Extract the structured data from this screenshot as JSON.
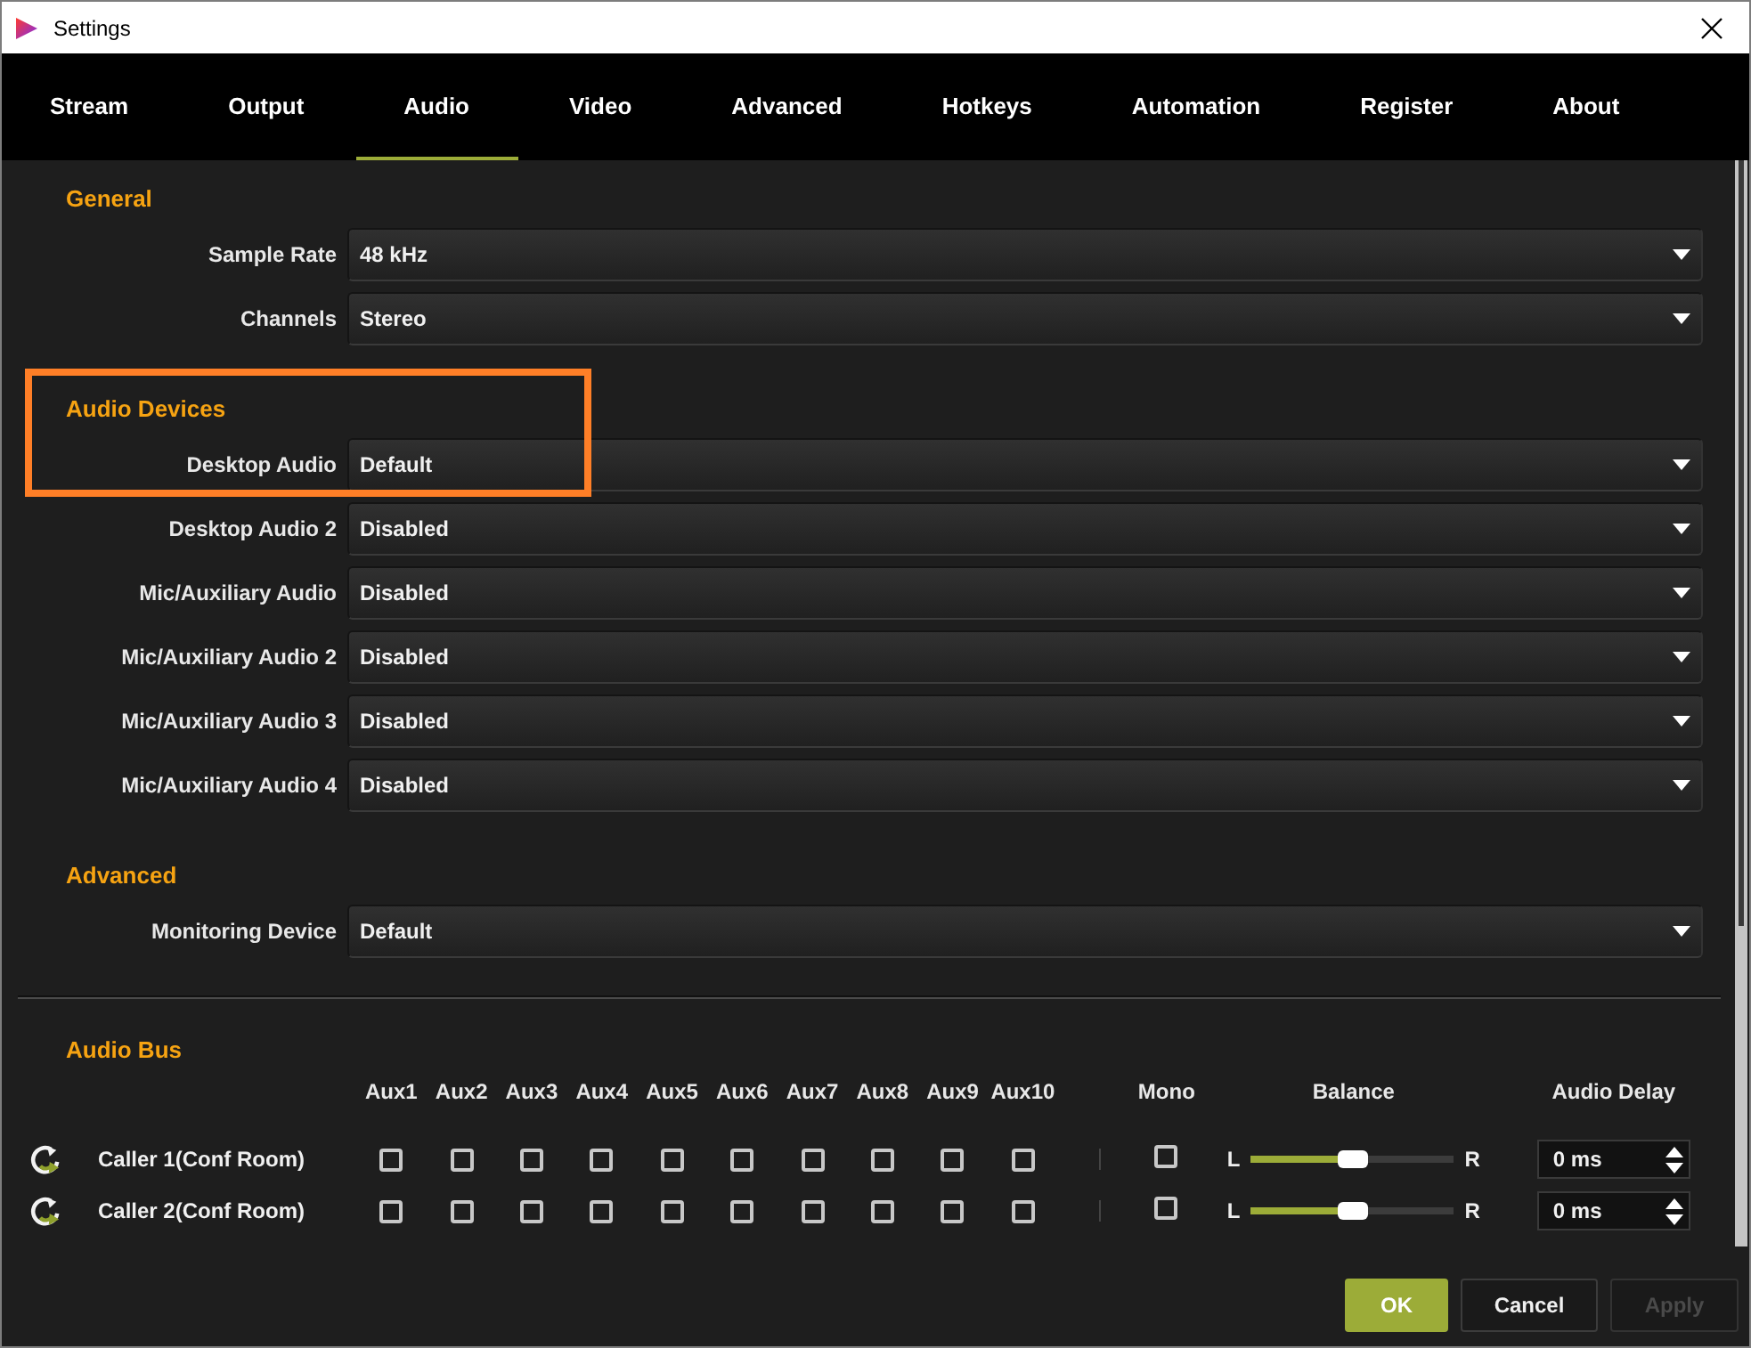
{
  "window": {
    "title": "Settings"
  },
  "tabs": [
    {
      "label": "Stream",
      "selected": false
    },
    {
      "label": "Output",
      "selected": false
    },
    {
      "label": "Audio",
      "selected": true
    },
    {
      "label": "Video",
      "selected": false
    },
    {
      "label": "Advanced",
      "selected": false
    },
    {
      "label": "Hotkeys",
      "selected": false
    },
    {
      "label": "Automation",
      "selected": false
    },
    {
      "label": "Register",
      "selected": false
    },
    {
      "label": "About",
      "selected": false
    }
  ],
  "sections": [
    {
      "title": "General",
      "highlighted": false,
      "fields": [
        {
          "label": "Sample Rate",
          "value": "48 kHz"
        },
        {
          "label": "Channels",
          "value": "Stereo"
        }
      ]
    },
    {
      "title": "Audio Devices",
      "highlighted": true,
      "fields": [
        {
          "label": "Desktop Audio",
          "value": "Default"
        },
        {
          "label": "Desktop Audio 2",
          "value": "Disabled"
        },
        {
          "label": "Mic/Auxiliary Audio",
          "value": "Disabled"
        },
        {
          "label": "Mic/Auxiliary Audio 2",
          "value": "Disabled"
        },
        {
          "label": "Mic/Auxiliary Audio 3",
          "value": "Disabled"
        },
        {
          "label": "Mic/Auxiliary Audio 4",
          "value": "Disabled"
        }
      ]
    },
    {
      "title": "Advanced",
      "highlighted": false,
      "fields": [
        {
          "label": "Monitoring Device",
          "value": "Default"
        }
      ]
    }
  ],
  "audio_bus": {
    "title": "Audio Bus",
    "columns": {
      "aux": [
        "Aux1",
        "Aux2",
        "Aux3",
        "Aux4",
        "Aux5",
        "Aux6",
        "Aux7",
        "Aux8",
        "Aux9",
        "Aux10"
      ],
      "mono": "Mono",
      "balance": "Balance",
      "delay": "Audio Delay"
    },
    "rows": [
      {
        "name": "Caller 1(Conf Room)",
        "aux": [
          {
            "checked": false
          },
          {
            "checked": false
          },
          {
            "checked": false
          },
          {
            "checked": false
          },
          {
            "checked": false
          },
          {
            "checked": false
          },
          {
            "checked": false
          },
          {
            "checked": false
          },
          {
            "checked": false
          },
          {
            "checked": false
          }
        ],
        "mono": {
          "checked": false
        },
        "balance": {
          "left": "L",
          "right": "R",
          "level": 0.5
        },
        "delay": "0 ms"
      },
      {
        "name": "Caller 2(Conf Room)",
        "aux": [
          {
            "checked": false
          },
          {
            "checked": false
          },
          {
            "checked": false
          },
          {
            "checked": false
          },
          {
            "checked": false
          },
          {
            "checked": false
          },
          {
            "checked": false
          },
          {
            "checked": false
          },
          {
            "checked": false
          },
          {
            "checked": false
          }
        ],
        "mono": {
          "checked": false
        },
        "balance": {
          "left": "L",
          "right": "R",
          "level": 0.5
        },
        "delay": "0 ms"
      }
    ]
  },
  "buttons": [
    {
      "label": "OK",
      "kind": "primary",
      "disabled": false
    },
    {
      "label": "Cancel",
      "kind": "secondary",
      "disabled": false
    },
    {
      "label": "Apply",
      "kind": "secondary",
      "disabled": true
    }
  ]
}
